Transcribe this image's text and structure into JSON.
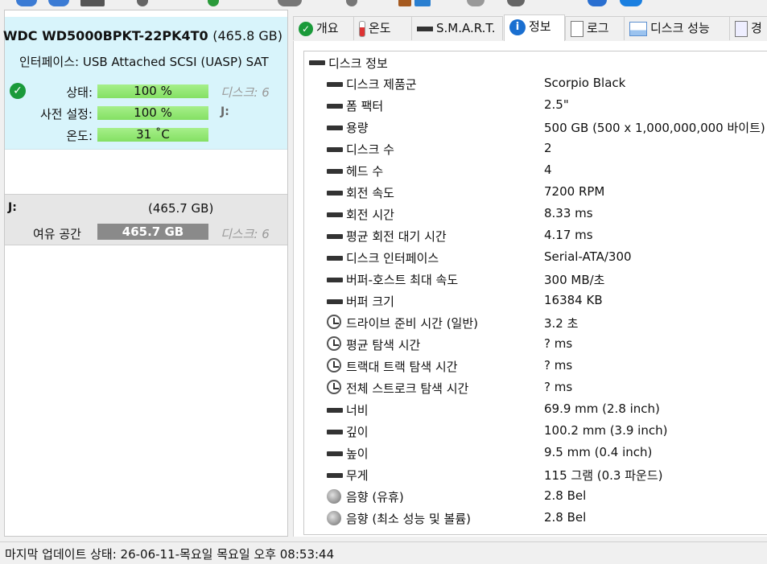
{
  "disk": {
    "model": "WDC WD5000BPKT-22PK4T0",
    "capacity": "(465.8 GB)",
    "interface_label": "인터페이스:",
    "interface_value": "USB Attached SCSI (UASP) SAT",
    "status_label": "상태:",
    "status_value": "100 %",
    "status_right": "디스크: 6",
    "preset_label": "사전 설정:",
    "preset_value": "100 %",
    "preset_right": "J:",
    "temp_label": "온도:",
    "temp_value": "31 ˚C"
  },
  "volume": {
    "name": "J:",
    "size": "(465.7 GB)",
    "free_label": "여유 공간",
    "free_value": "465.7 GB",
    "right": "디스크: 6"
  },
  "tabs": [
    {
      "label": "개요",
      "icon": "check-icon"
    },
    {
      "label": "온도",
      "icon": "thermometer-icon"
    },
    {
      "label": "S.M.A.R.T.",
      "icon": "drive-icon"
    },
    {
      "label": "정보",
      "icon": "info-icon",
      "active": true
    },
    {
      "label": "로그",
      "icon": "document-icon"
    },
    {
      "label": "디스크 성능",
      "icon": "chart-icon"
    },
    {
      "label": "경",
      "icon": "clipboard-icon"
    }
  ],
  "section_title": "디스크 정보",
  "items": [
    {
      "key": "디스크 제품군",
      "value": "Scorpio Black",
      "icon": "drive-icon"
    },
    {
      "key": "폼 팩터",
      "value": "2.5\"",
      "icon": "drive-icon"
    },
    {
      "key": "용량",
      "value": "500 GB (500 x 1,000,000,000 바이트)",
      "icon": "drive-icon"
    },
    {
      "key": "디스크 수",
      "value": "2",
      "icon": "drive-icon"
    },
    {
      "key": "헤드 수",
      "value": "4",
      "icon": "drive-icon"
    },
    {
      "key": "회전 속도",
      "value": "7200 RPM",
      "icon": "drive-icon"
    },
    {
      "key": "회전 시간",
      "value": "8.33 ms",
      "icon": "drive-icon"
    },
    {
      "key": "평균 회전 대기 시간",
      "value": "4.17 ms",
      "icon": "drive-icon"
    },
    {
      "key": "디스크 인터페이스",
      "value": "Serial-ATA/300",
      "icon": "drive-icon"
    },
    {
      "key": "버퍼-호스트 최대 속도",
      "value": "300 MB/초",
      "icon": "drive-icon"
    },
    {
      "key": "버퍼 크기",
      "value": "16384 KB",
      "icon": "drive-icon"
    },
    {
      "key": "드라이브 준비 시간 (일반)",
      "value": "3.2 초",
      "icon": "clock-icon"
    },
    {
      "key": "평균 탐색 시간",
      "value": "? ms",
      "icon": "clock-icon"
    },
    {
      "key": "트랙대 트랙 탐색 시간",
      "value": "? ms",
      "icon": "clock-icon"
    },
    {
      "key": "전체 스트로크 탐색 시간",
      "value": "? ms",
      "icon": "clock-icon"
    },
    {
      "key": "너비",
      "value": "69.9 mm (2.8 inch)",
      "icon": "drive-icon"
    },
    {
      "key": "깊이",
      "value": "100.2 mm (3.9 inch)",
      "icon": "drive-icon"
    },
    {
      "key": "높이",
      "value": "9.5 mm (0.4 inch)",
      "icon": "drive-icon"
    },
    {
      "key": "무게",
      "value": "115 그램 (0.3 파운드)",
      "icon": "drive-icon"
    },
    {
      "key": "음향 (유휴)",
      "value": "2.8 Bel",
      "icon": "speaker-icon"
    },
    {
      "key": "음향 (최소 성능 및 볼륨)",
      "value": "2.8 Bel",
      "icon": "speaker-icon"
    }
  ],
  "status_bar": "마지막 업데이트 상태: 26-06-11-목요일 목요일 오후 08:53:44"
}
